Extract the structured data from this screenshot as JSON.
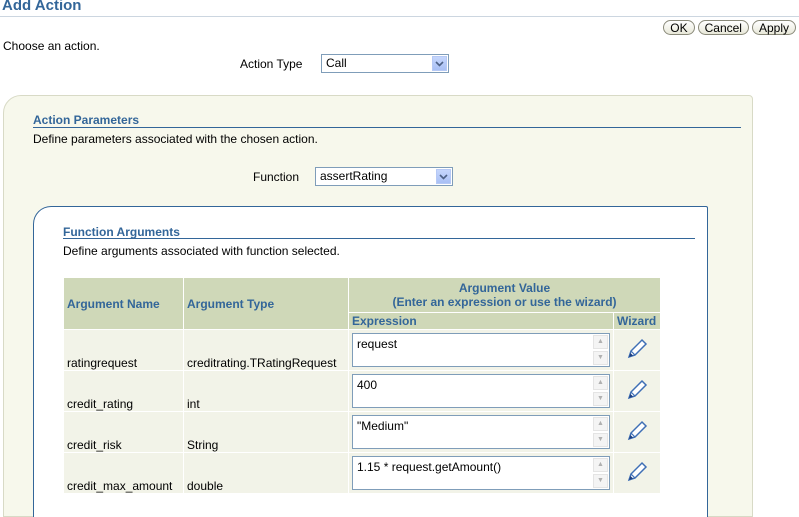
{
  "page": {
    "title": "Add Action",
    "instruction": "Choose an action."
  },
  "buttons": {
    "ok": "OK",
    "cancel": "Cancel",
    "apply": "Apply"
  },
  "action_type": {
    "label": "Action Type",
    "value": "Call"
  },
  "action_parameters": {
    "title": "Action Parameters",
    "description": "Define parameters associated with the chosen action.",
    "function_label": "Function",
    "function_value": "assertRating"
  },
  "function_arguments": {
    "title": "Function Arguments",
    "description": "Define arguments associated with function selected.",
    "headers": {
      "name": "Argument Name",
      "type": "Argument Type",
      "value": "Argument Value",
      "value_hint": "(Enter an expression or use the wizard)",
      "expression": "Expression",
      "wizard": "Wizard"
    },
    "rows": [
      {
        "name": "ratingrequest",
        "type": "creditrating.TRatingRequest",
        "expression": "request"
      },
      {
        "name": "credit_rating",
        "type": "int",
        "expression": "400"
      },
      {
        "name": "credit_risk",
        "type": "String",
        "expression": "\"Medium\""
      },
      {
        "name": "credit_max_amount",
        "type": "double",
        "expression": "1.15 * request.getAmount()"
      }
    ]
  },
  "colors": {
    "brand": "#336699",
    "header_bg": "#cfd8b8",
    "panel_bg": "#f7f8ec"
  }
}
